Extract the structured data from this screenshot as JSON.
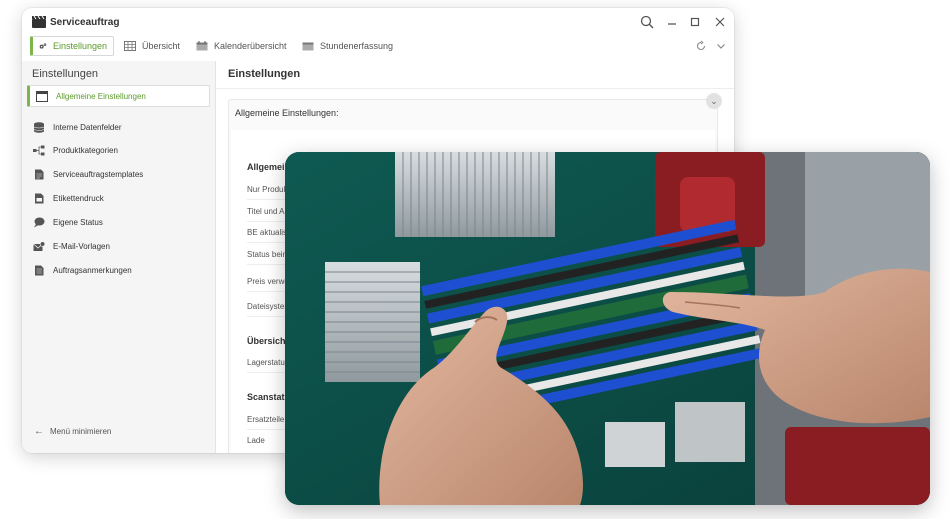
{
  "window": {
    "title": "Serviceauftrag"
  },
  "tabs": [
    {
      "label": "Einstellungen",
      "active": true
    },
    {
      "label": "Übersicht"
    },
    {
      "label": "Kalenderübersicht"
    },
    {
      "label": "Stundenerfassung"
    }
  ],
  "sidebar": {
    "title": "Einstellungen",
    "items": [
      {
        "label": "Allgemeine Einstellungen",
        "icon": "window-icon",
        "active": true
      },
      {
        "label": "Interne Datenfelder",
        "icon": "database-icon"
      },
      {
        "label": "Produktkategorien",
        "icon": "hierarchy-icon"
      },
      {
        "label": "Serviceauftragstemplates",
        "icon": "document-icon"
      },
      {
        "label": "Etikettendruck",
        "icon": "label-print-icon"
      },
      {
        "label": "Eigene Status",
        "icon": "chat-bubble-icon"
      },
      {
        "label": "E-Mail-Vorlagen",
        "icon": "mail-icon"
      },
      {
        "label": "Auftragsanmerkungen",
        "icon": "notes-icon"
      }
    ],
    "minimize_label": "Menü minimieren"
  },
  "content": {
    "title": "Einstellungen",
    "panel_title": "Allgemeine Einstellungen:",
    "sections": [
      {
        "heading": "Allgemein",
        "rows": [
          "Nur Produk",
          "Titel und A",
          "BE aktualis",
          "Status beim",
          "Preis verwe",
          "Dateisyster"
        ]
      },
      {
        "heading": "Übersicht:",
        "rows": [
          "Lagerstatus"
        ]
      },
      {
        "heading": "Scanstatio",
        "rows": [
          "Ersatzteile",
          "Lade"
        ]
      }
    ]
  },
  "photo": {
    "subject": "hands-installing-ram-module-icon"
  },
  "colors": {
    "accent": "#7ab648",
    "accent_text": "#5a9a2a",
    "sidebar_bg": "#f5f5f5"
  }
}
